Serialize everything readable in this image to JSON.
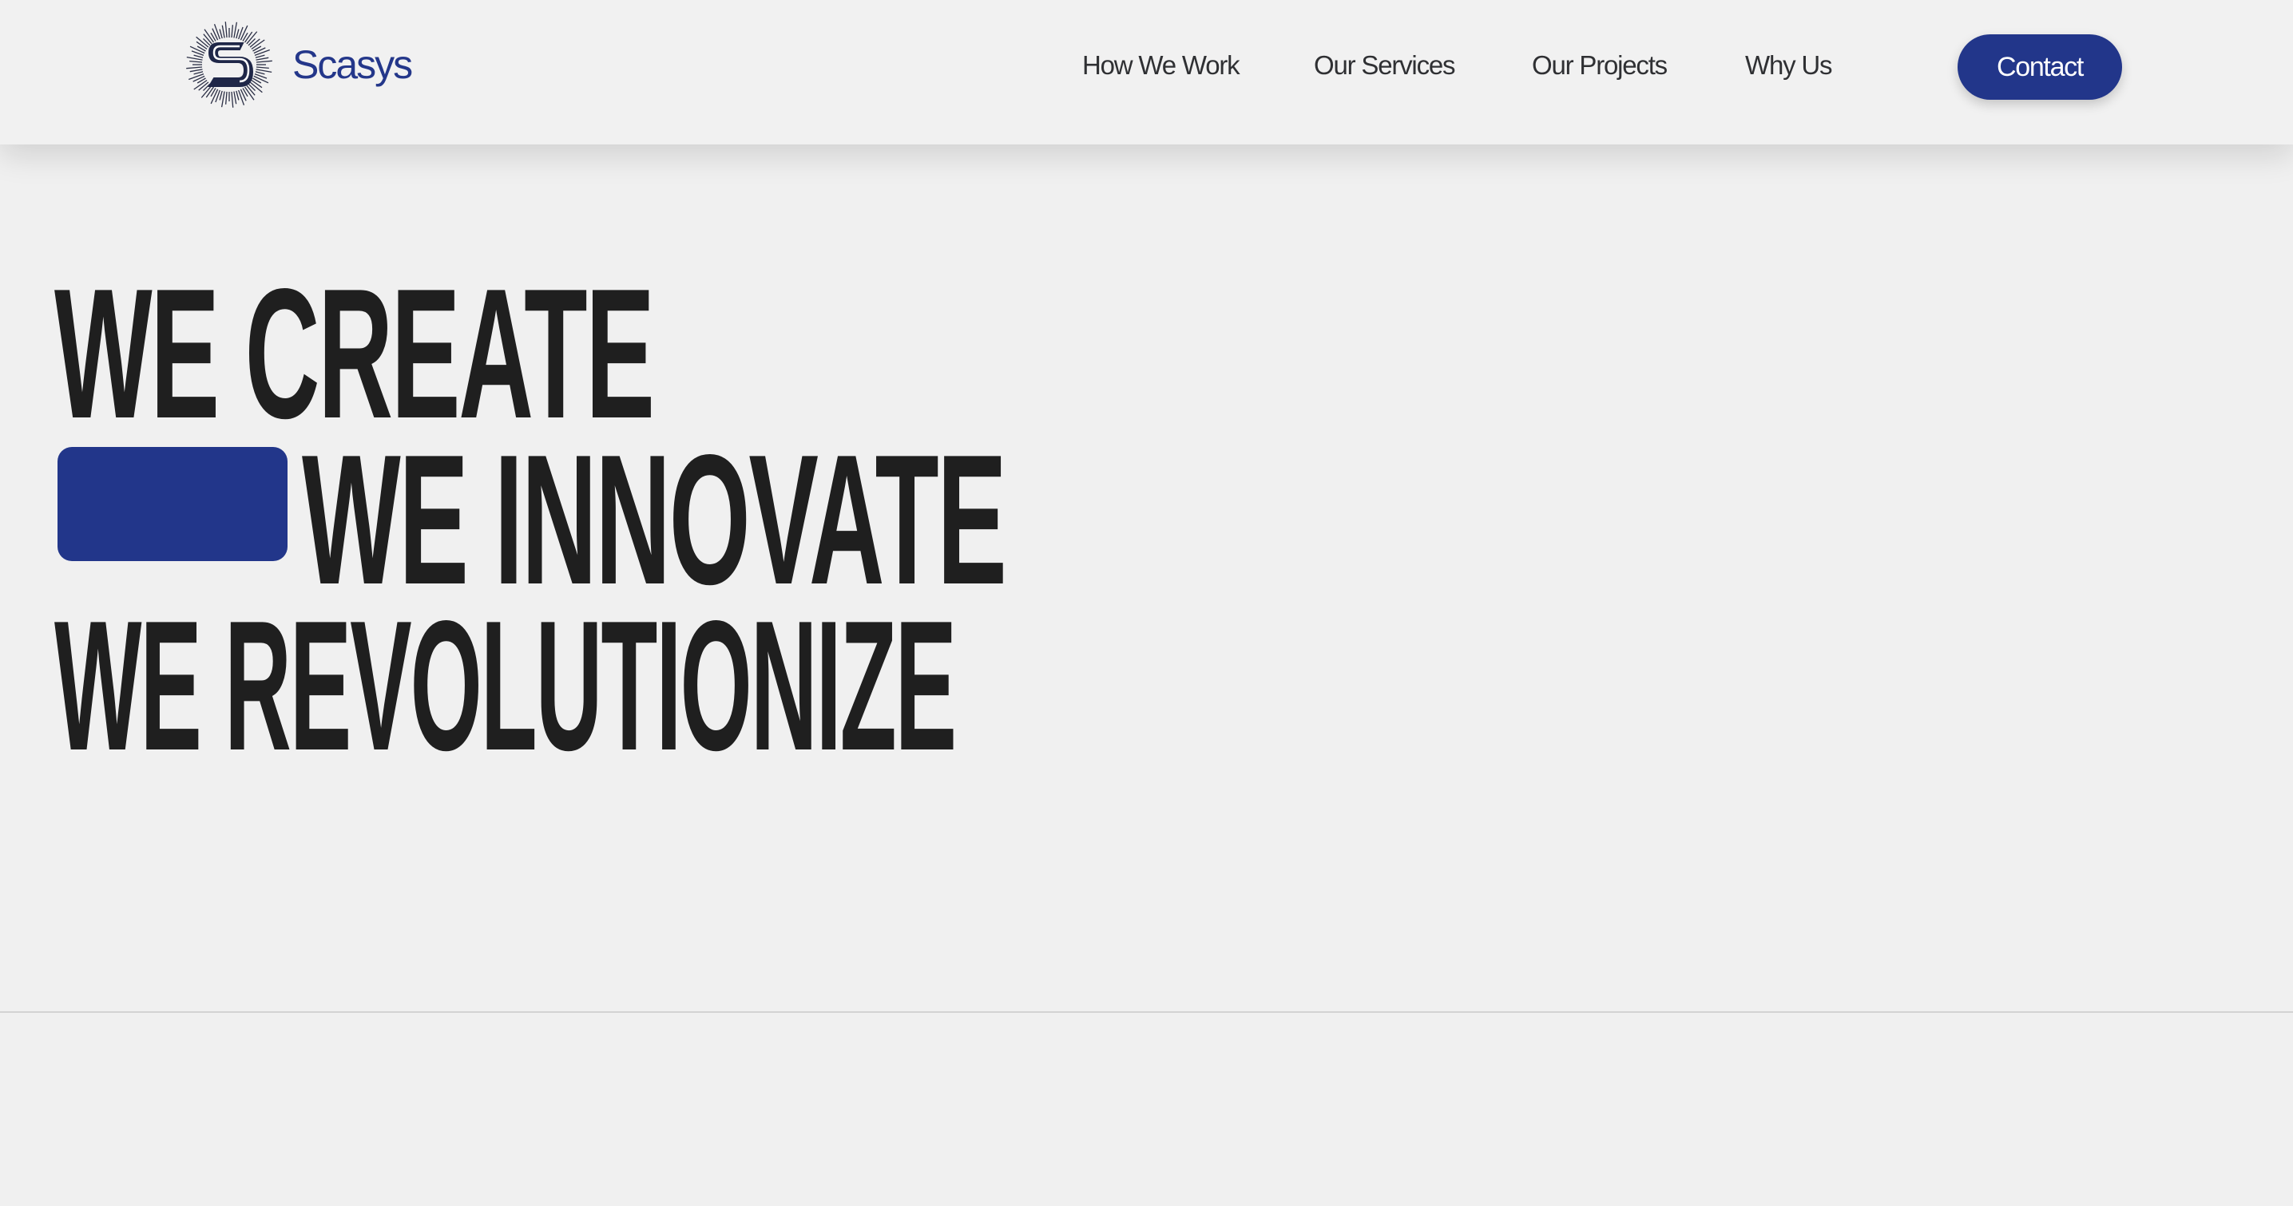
{
  "brand": {
    "name": "Scasys",
    "logo_icon": "starburst-s-logo-icon",
    "color": "#24378a"
  },
  "nav": {
    "items": [
      {
        "label": "How We Work"
      },
      {
        "label": "Our Services"
      },
      {
        "label": "Our Projects"
      },
      {
        "label": "Why Us"
      }
    ],
    "contact_label": "Contact"
  },
  "hero": {
    "line1": "WE CREATE",
    "line2": "WE INNOVATE",
    "line3": "WE REVOLUTIONIZE",
    "accent_color": "#22368a"
  }
}
